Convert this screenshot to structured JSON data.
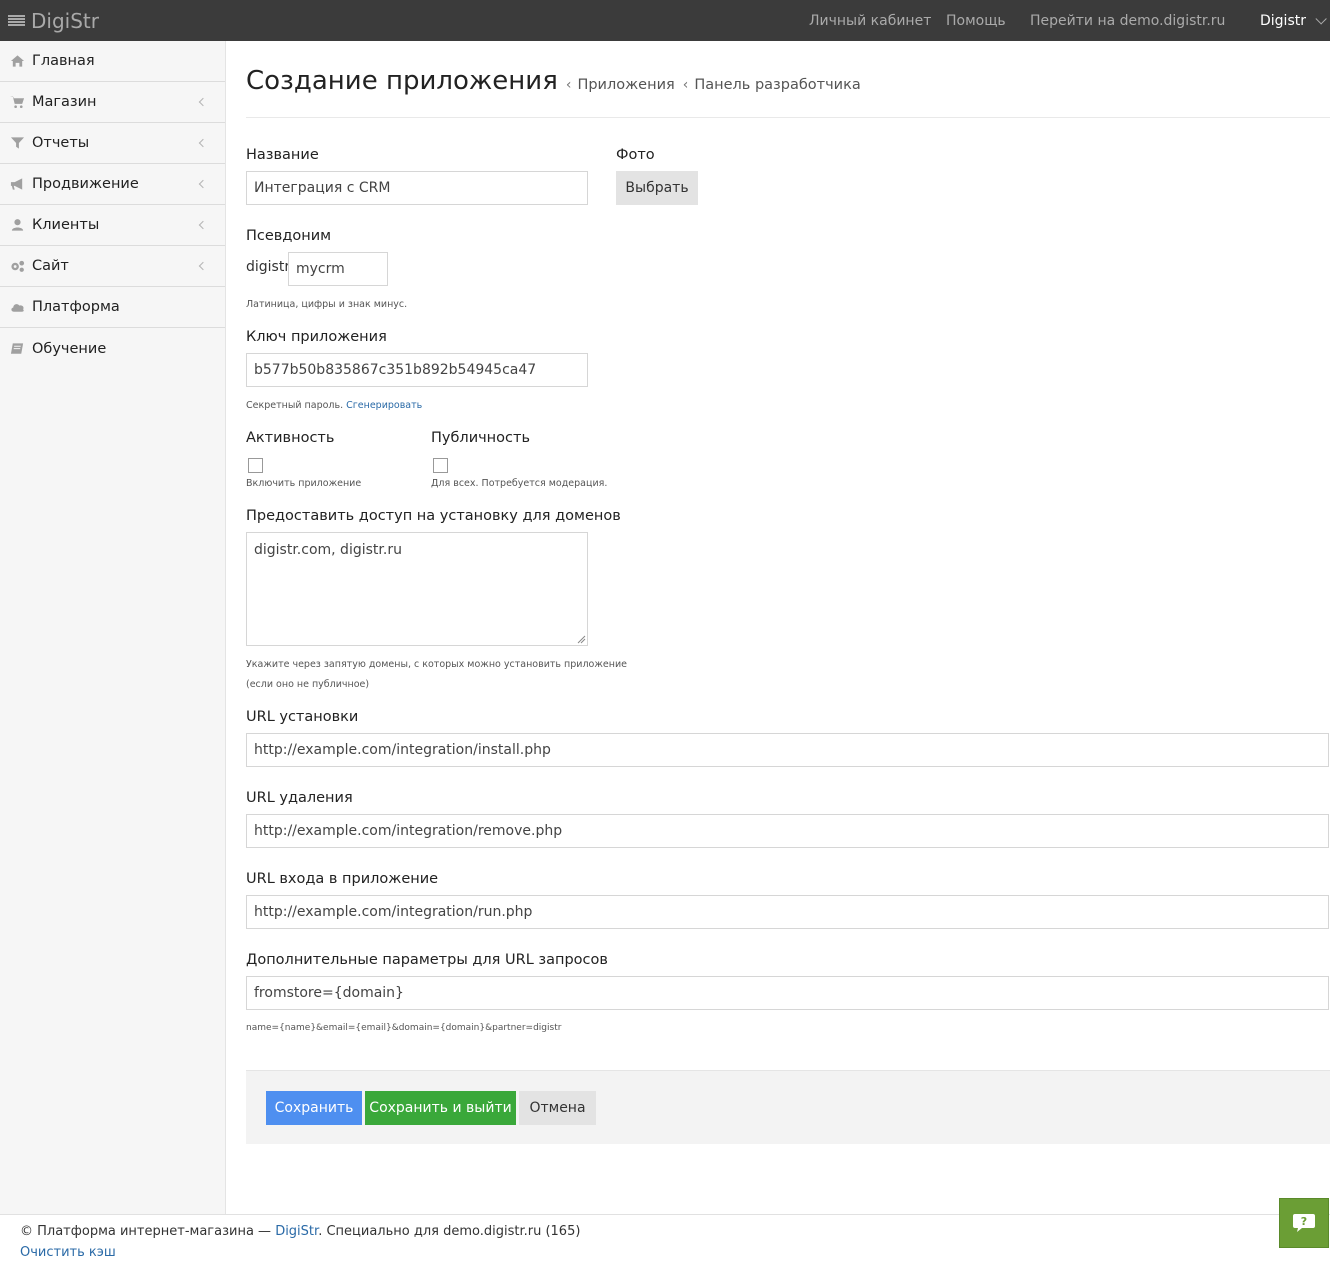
{
  "topbar": {
    "brand": "DigiStr",
    "links": [
      "Личный кабинет",
      "Помощь",
      "Перейти на demo.digistr.ru"
    ],
    "user": "Digistr"
  },
  "sidebar": {
    "items": [
      {
        "label": "Главная",
        "icon": "home-icon"
      },
      {
        "label": "Магазин",
        "icon": "cart-icon"
      },
      {
        "label": "Отчеты",
        "icon": "filter-icon"
      },
      {
        "label": "Продвижение",
        "icon": "megaphone-icon"
      },
      {
        "label": "Клиенты",
        "icon": "user-icon"
      },
      {
        "label": "Сайт",
        "icon": "gears-icon"
      },
      {
        "label": "Платформа",
        "icon": "cloud-icon"
      },
      {
        "label": "Обучение",
        "icon": "book-icon"
      }
    ]
  },
  "page": {
    "title": "Создание приложения",
    "breadcrumbs": [
      "Приложения",
      "Панель разработчика"
    ]
  },
  "form": {
    "name_label": "Название",
    "name_value": "Интеграция с CRM",
    "photo_label": "Фото",
    "photo_button": "Выбрать",
    "alias_label": "Псевдоним",
    "alias_prefix": "digistr-",
    "alias_value": "mycrm",
    "alias_help": "Латиница, цифры и знак минус.",
    "key_label": "Ключ приложения",
    "key_value": "b577b50b835867c351b892b54945ca47",
    "key_help": "Секретный пароль.",
    "key_generate": "Сгенерировать",
    "active_label": "Активность",
    "active_help": "Включить приложение",
    "public_label": "Публичность",
    "public_help": "Для всех. Потребуется модерация.",
    "domains_label": "Предоставить доступ на установку для доменов",
    "domains_value": "digistr.com, digistr.ru",
    "domains_help_1": "Укажите через запятую домены, с которых можно установить приложение",
    "domains_help_2": "(если оно не публичное)",
    "install_label": "URL установки",
    "install_value": "http://example.com/integration/install.php",
    "remove_label": "URL удаления",
    "remove_value": "http://example.com/integration/remove.php",
    "run_label": "URL входа в приложение",
    "run_value": "http://example.com/integration/run.php",
    "params_label": "Дополнительные параметры для URL запросов",
    "params_value": "fromstore={domain}",
    "params_help": "name={name}&email={email}&domain={domain}&partner=digistr"
  },
  "actions": {
    "save": "Сохранить",
    "save_exit": "Сохранить и выйти",
    "cancel": "Отмена"
  },
  "footer": {
    "prefix": "© Платформа интернет-магазина — ",
    "brand_link": "DigiStr",
    "suffix": ". Специально для demo.digistr.ru (165)",
    "clear_cache": "Очистить кэш"
  },
  "colors": {
    "topbar": "#3b3b3b",
    "save": "#4e8ff0",
    "save_exit": "#3aa83a",
    "help_fab": "#6b9e35",
    "link": "#2a6aa7"
  }
}
